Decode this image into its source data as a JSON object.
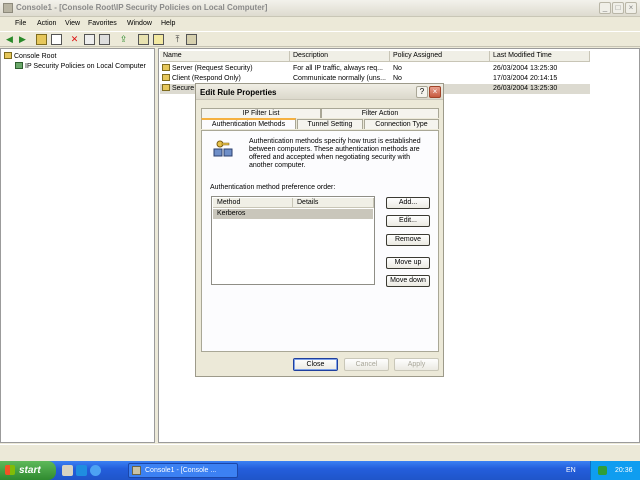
{
  "window": {
    "title": "Console1 - [Console Root\\IP Security Policies on Local Computer]",
    "controls": [
      "_",
      "□",
      "×"
    ]
  },
  "menu": [
    "File",
    "Action",
    "View",
    "Favorites",
    "Window",
    "Help"
  ],
  "tree": {
    "root": "Console Root",
    "child": "IP Security Policies on Local Computer"
  },
  "list": {
    "columns": [
      "Name",
      "Description",
      "Policy Assigned",
      "Last Modified Time"
    ],
    "rows": [
      {
        "name": "Server (Request Security)",
        "description": "For all IP traffic, always req...",
        "assigned": "No",
        "modified": "26/03/2004 13:25:30"
      },
      {
        "name": "Client (Respond Only)",
        "description": "Communicate normally (uns...",
        "assigned": "No",
        "modified": "17/03/2004 20:14:15"
      },
      {
        "name": "Secure S",
        "description": "",
        "assigned": "",
        "modified": "26/03/2004 13:25:30"
      }
    ]
  },
  "dialog": {
    "title": "Edit Rule Properties",
    "help_btn": "?",
    "close_btn": "×",
    "tabs_top": [
      "IP Filter List",
      "Filter Action"
    ],
    "tabs_bottom": [
      "Authentication Methods",
      "Tunnel Setting",
      "Connection Type"
    ],
    "active_tab": "Authentication Methods",
    "description": "Authentication methods specify how trust is established between computers. These authentication methods are offered and accepted when negotiating security with another computer.",
    "pref_label": "Authentication method preference order:",
    "method_columns": [
      "Method",
      "Details"
    ],
    "methods": [
      {
        "method": "Kerberos",
        "details": ""
      }
    ],
    "side_buttons": {
      "add": "Add...",
      "edit": "Edit...",
      "remove": "Remove",
      "move_up": "Move up",
      "move_down": "Move down"
    },
    "footer": {
      "close": "Close",
      "cancel": "Cancel",
      "apply": "Apply"
    }
  },
  "taskbar": {
    "start": "start",
    "task": "Console1 - [Console ...",
    "lang": "EN",
    "time": "20:36"
  }
}
